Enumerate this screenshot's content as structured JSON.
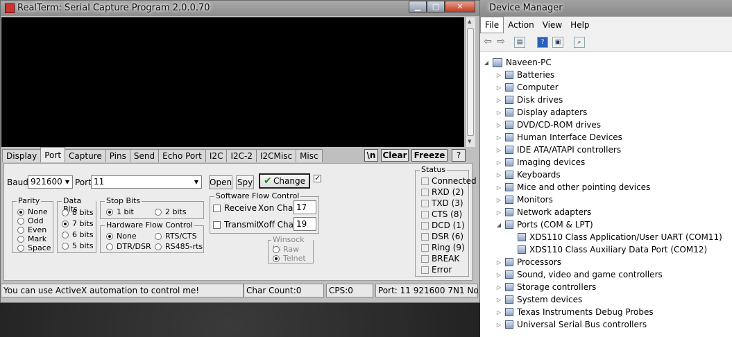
{
  "realterm": {
    "title": "RealTerm: Serial Capture Program 2.0.0.70",
    "tabs": [
      "Display",
      "Port",
      "Capture",
      "Pins",
      "Send",
      "Echo Port",
      "I2C",
      "I2C-2",
      "I2CMisc",
      "Misc"
    ],
    "selected_tab": "Port",
    "tab_buttons": {
      "newline": "\\n",
      "clear": "Clear",
      "freeze": "Freeze",
      "help": "?"
    },
    "port": {
      "baud_label": "Baud",
      "baud_value": "921600",
      "port_label": "Port",
      "port_value": "11",
      "open_button": "Open",
      "spy_button": "Spy",
      "change_button": "Change",
      "parity": {
        "legend": "Parity",
        "options": [
          "None",
          "Odd",
          "Even",
          "Mark",
          "Space"
        ],
        "selected": "None"
      },
      "data_bits": {
        "legend": "Data Bits",
        "options": [
          "8 bits",
          "7 bits",
          "6 bits",
          "5 bits"
        ],
        "selected": "7 bits"
      },
      "stop_bits": {
        "legend": "Stop Bits",
        "options": [
          "1 bit",
          "2 bits"
        ],
        "selected": "1 bit"
      },
      "hw_flow": {
        "legend": "Hardware Flow Control",
        "options": [
          "None",
          "RTS/CTS",
          "DTR/DSR",
          "RS485-rts"
        ],
        "selected": "None"
      },
      "sw_flow": {
        "legend": "Software Flow Control",
        "receive_label": "Receive",
        "transmit_label": "Transmit",
        "xon_label": "Xon Char:",
        "xon_value": "17",
        "xoff_label": "Xoff Char:",
        "xoff_value": "19"
      },
      "winsock": {
        "legend": "Winsock is:",
        "options": [
          "Raw",
          "Telnet"
        ],
        "selected": "Telnet"
      }
    },
    "status": {
      "legend": "Status",
      "items": [
        "Connected",
        "RXD (2)",
        "TXD (3)",
        "CTS (8)",
        "DCD (1)",
        "DSR (6)",
        "Ring (9)",
        "BREAK",
        "Error"
      ]
    },
    "statusbar": {
      "message": "You can use ActiveX automation to control me!",
      "char_count": "Char Count:0",
      "cps": "CPS:0",
      "port_info": "Port: 11 921600 7N1 No"
    }
  },
  "device_manager": {
    "title": "Device Manager",
    "menu": [
      "File",
      "Action",
      "View",
      "Help"
    ],
    "root": "Naveen-PC",
    "categories": [
      "Batteries",
      "Computer",
      "Disk drives",
      "Display adapters",
      "DVD/CD-ROM drives",
      "Human Interface Devices",
      "IDE ATA/ATAPI controllers",
      "Imaging devices",
      "Keyboards",
      "Mice and other pointing devices",
      "Monitors",
      "Network adapters",
      "Ports (COM & LPT)"
    ],
    "ports_children": [
      "XDS110 Class Application/User UART (COM11)",
      "XDS110 Class Auxiliary Data Port (COM12)"
    ],
    "categories_after": [
      "Processors",
      "Sound, video and game controllers",
      "Storage controllers",
      "System devices",
      "Texas Instruments Debug Probes",
      "Universal Serial Bus controllers"
    ]
  }
}
